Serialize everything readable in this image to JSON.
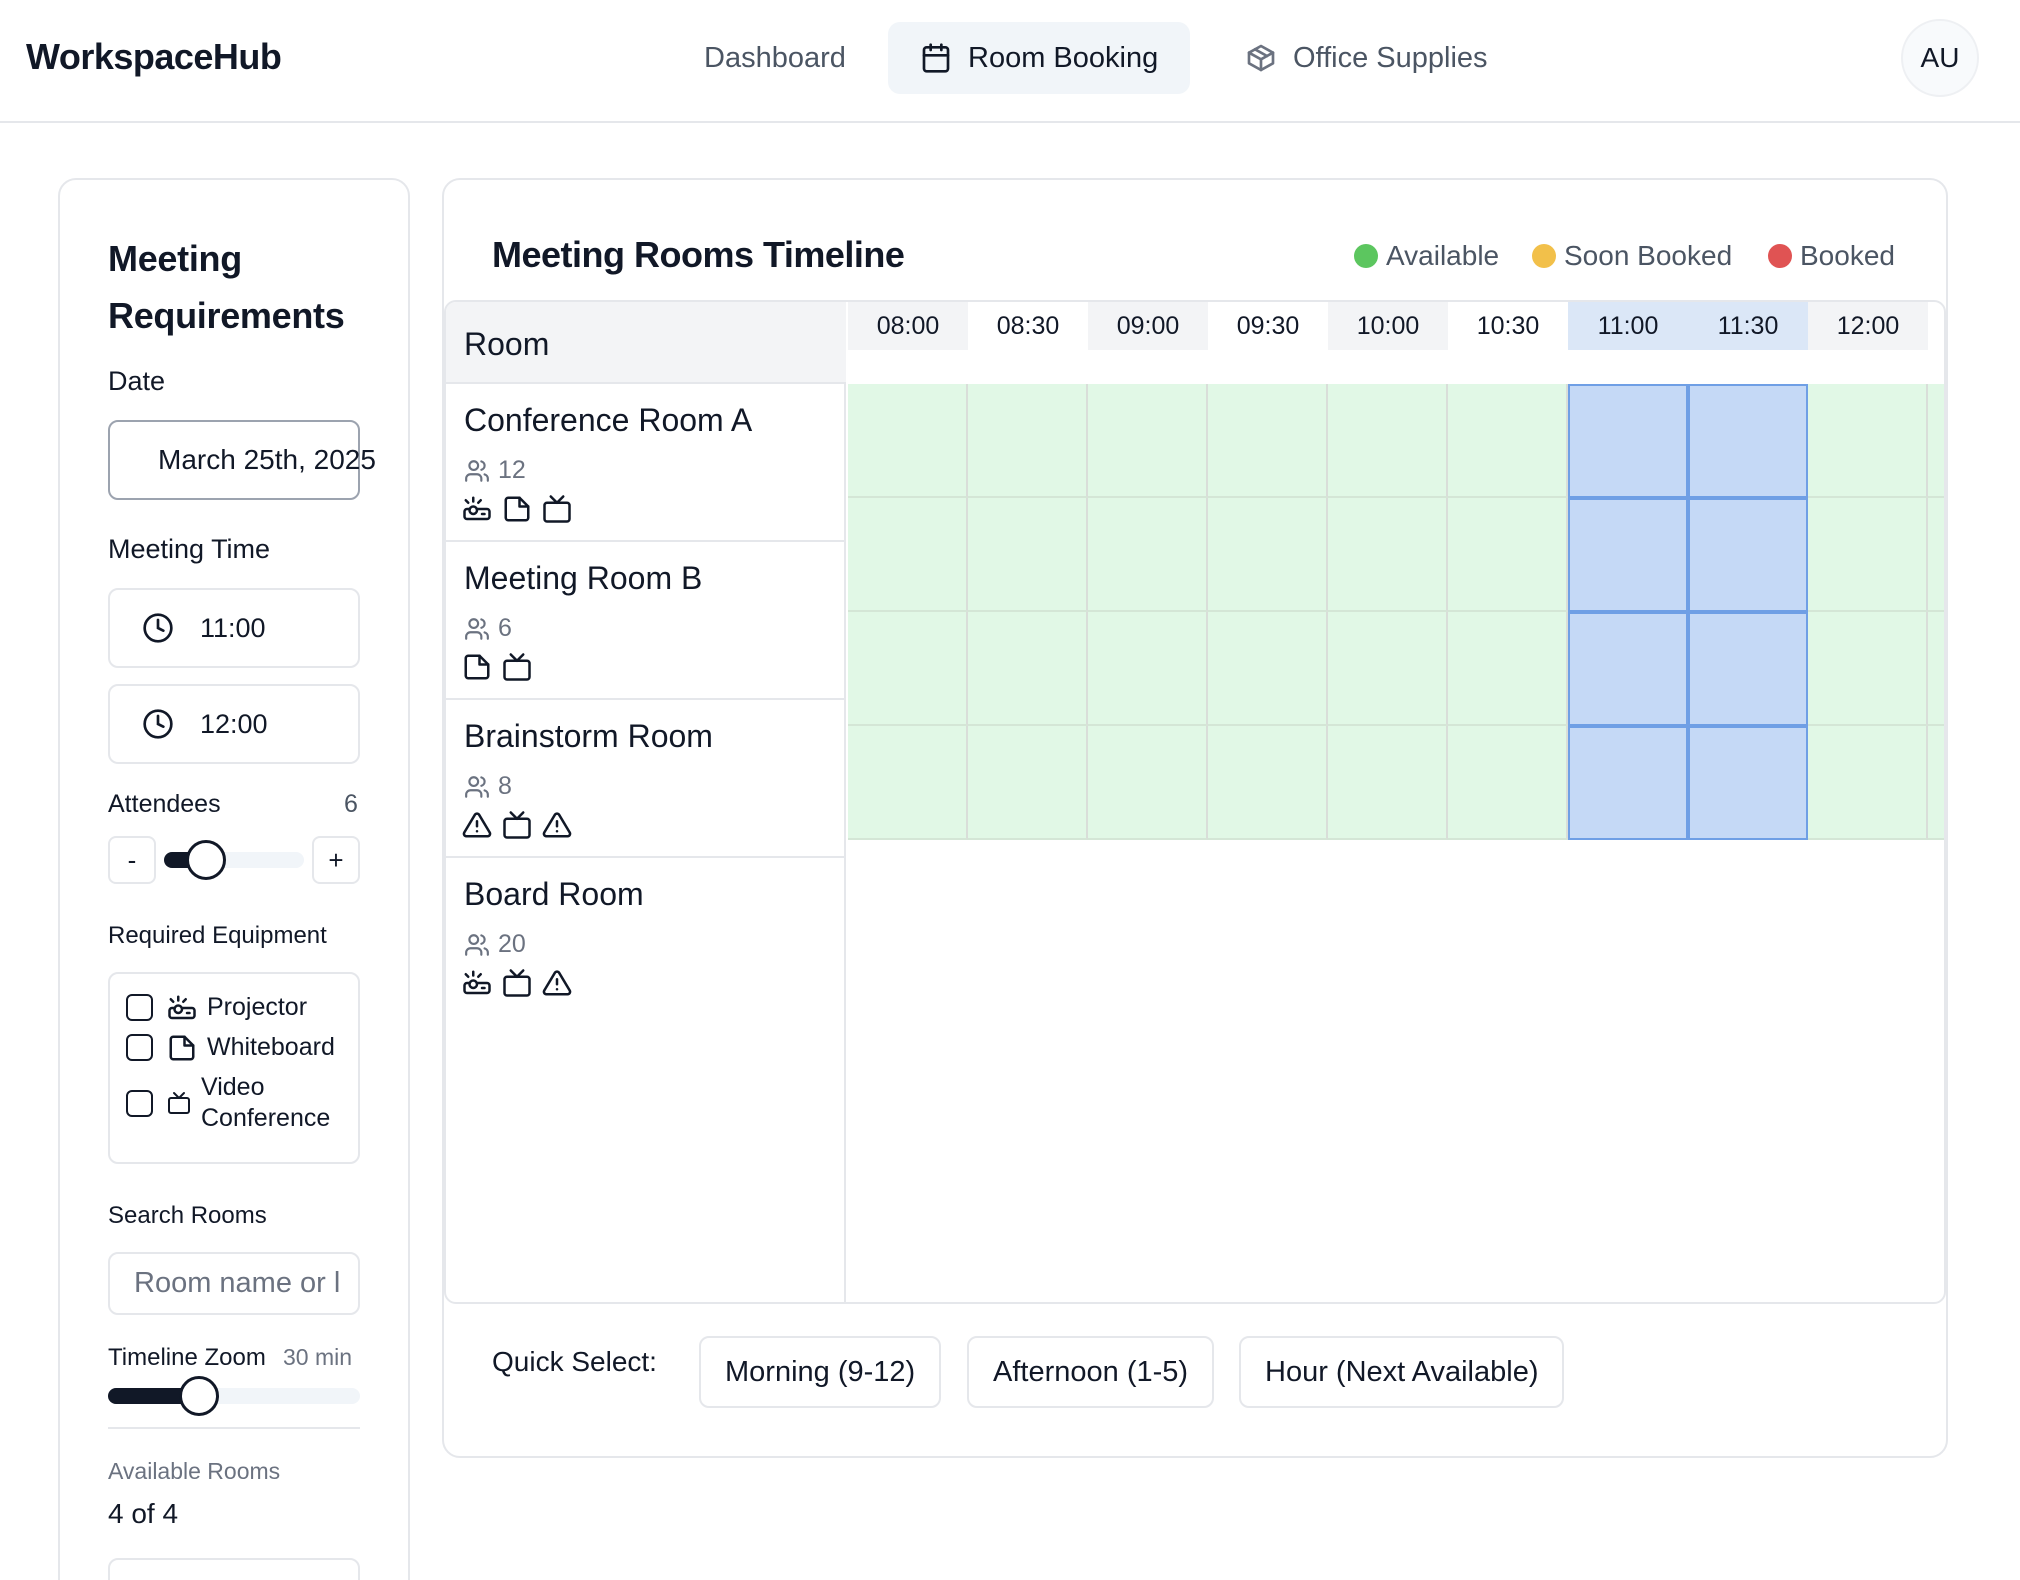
{
  "app": {
    "brand": "WorkspaceHub",
    "avatar": "AU"
  },
  "nav": [
    {
      "label": "Dashboard",
      "icon": "none",
      "active": false
    },
    {
      "label": "Room Booking",
      "icon": "calendar-icon",
      "active": true
    },
    {
      "label": "Office Supplies",
      "icon": "package-icon",
      "active": false
    }
  ],
  "requirements": {
    "title": "Meeting Requirements",
    "date_label": "Date",
    "date_value": "March 25th, 2025",
    "time_label": "Meeting Time",
    "start_time": "11:00",
    "end_time": "12:00",
    "attendees_label": "Attendees",
    "attendees_value": "6",
    "attendees_level": 0.3,
    "minus": "-",
    "plus": "+",
    "equipment_label": "Required Equipment",
    "equipment": [
      {
        "label": "Projector",
        "icon": "projector-icon",
        "checked": false
      },
      {
        "label": "Whiteboard",
        "icon": "whiteboard-icon",
        "checked": false
      },
      {
        "label": "Video Conference",
        "icon": "video-icon",
        "checked": false
      }
    ],
    "search_label": "Search Rooms",
    "search_placeholder": "Room name or l",
    "zoom_label": "Timeline Zoom",
    "zoom_value": "30 min",
    "zoom_level": 0.36,
    "available_label": "Available Rooms",
    "available_value": "4 of 4"
  },
  "timeline": {
    "title": "Meeting Rooms Timeline",
    "legend": [
      {
        "label": "Available",
        "color": "#5cc65f"
      },
      {
        "label": "Soon Booked",
        "color": "#f2c04a"
      },
      {
        "label": "Booked",
        "color": "#e05353"
      }
    ],
    "room_header": "Room",
    "slots": [
      "08:00",
      "08:30",
      "09:00",
      "09:30",
      "10:00",
      "10:30",
      "11:00",
      "11:30",
      "12:00"
    ],
    "selected_slots": [
      "11:00",
      "11:30"
    ],
    "rooms": [
      {
        "name": "Conference Room A",
        "capacity": "12",
        "equipment": [
          "projector-icon",
          "whiteboard-icon",
          "video-icon"
        ]
      },
      {
        "name": "Meeting Room B",
        "capacity": "6",
        "equipment": [
          "whiteboard-icon",
          "video-icon"
        ]
      },
      {
        "name": "Brainstorm Room",
        "capacity": "8",
        "equipment": [
          "warning-icon",
          "video-icon",
          "warning-icon"
        ]
      },
      {
        "name": "Board Room",
        "capacity": "20",
        "equipment": [
          "projector-icon",
          "video-icon",
          "warning-icon"
        ]
      }
    ],
    "quick_select_label": "Quick Select:",
    "quick_select": [
      "Morning (9-12)",
      "Afternoon (1-5)",
      "Hour (Next Available)"
    ]
  }
}
